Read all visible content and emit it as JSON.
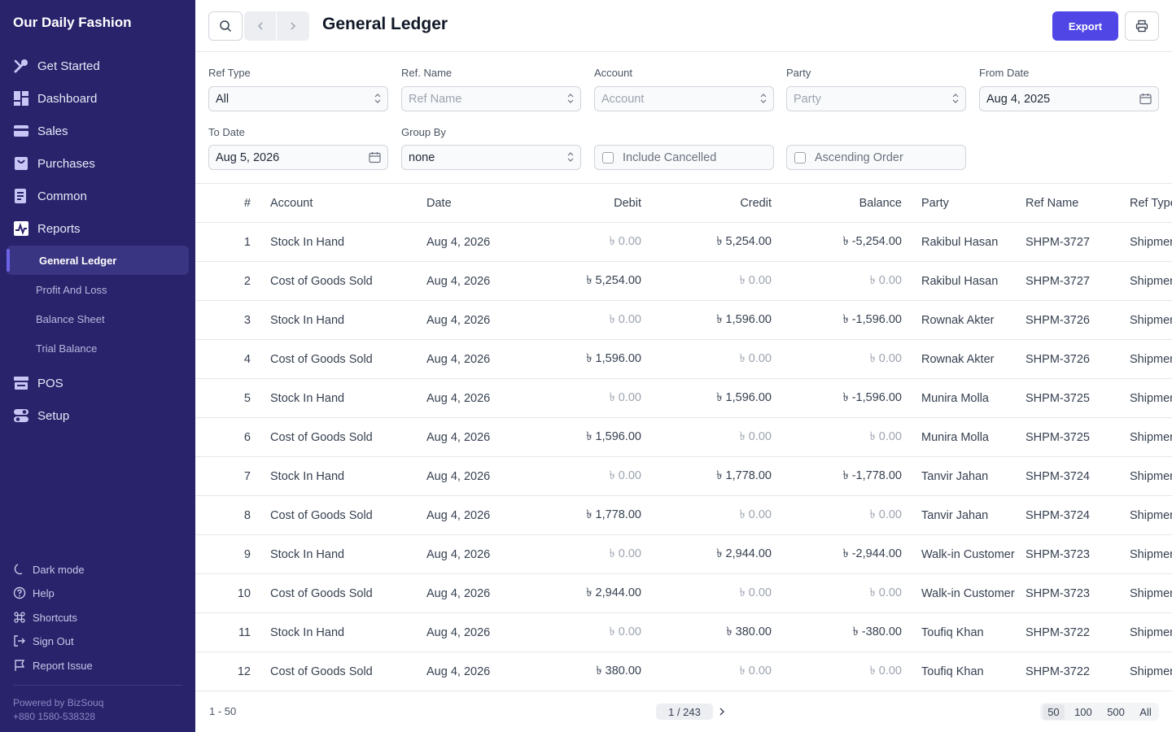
{
  "app": {
    "name": "Our Daily Fashion"
  },
  "sidebar": {
    "items": [
      {
        "label": "Get Started",
        "icon": "tools-icon"
      },
      {
        "label": "Dashboard",
        "icon": "dashboard-icon"
      },
      {
        "label": "Sales",
        "icon": "sales-card-icon"
      },
      {
        "label": "Purchases",
        "icon": "purchases-bag-icon"
      },
      {
        "label": "Common",
        "icon": "common-doc-icon"
      },
      {
        "label": "Reports",
        "icon": "reports-chart-icon"
      },
      {
        "label": "POS",
        "icon": "pos-store-icon"
      },
      {
        "label": "Setup",
        "icon": "setup-toggle-icon"
      }
    ],
    "report_subitems": [
      "General Ledger",
      "Profit And Loss",
      "Balance Sheet",
      "Trial Balance"
    ],
    "active_subitem": "General Ledger",
    "footer_items": [
      "Dark mode",
      "Help",
      "Shortcuts",
      "Sign Out",
      "Report Issue"
    ],
    "powered_by": "Powered by BizSouq",
    "phone": "+880 1580-538328"
  },
  "header": {
    "title": "General Ledger",
    "export_label": "Export"
  },
  "filters": {
    "ref_type": {
      "label": "Ref Type",
      "value": "All"
    },
    "ref_name": {
      "label": "Ref. Name",
      "placeholder": "Ref Name"
    },
    "account": {
      "label": "Account",
      "placeholder": "Account"
    },
    "party": {
      "label": "Party",
      "placeholder": "Party"
    },
    "from_date": {
      "label": "From Date",
      "value": "Aug 4, 2025"
    },
    "to_date": {
      "label": "To Date",
      "value": "Aug 5, 2026"
    },
    "group_by": {
      "label": "Group By",
      "value": "none"
    },
    "include_cancelled": {
      "label": "Include Cancelled",
      "checked": false
    },
    "ascending_order": {
      "label": "Ascending Order",
      "checked": false
    }
  },
  "table": {
    "columns": [
      "#",
      "Account",
      "Date",
      "Debit",
      "Credit",
      "Balance",
      "Party",
      "Ref Name",
      "Ref Type"
    ],
    "rows": [
      {
        "num": "1",
        "account": "Stock In Hand",
        "date": "Aug 4, 2026",
        "debit": "৳ 0.00",
        "credit": "৳ 5,254.00",
        "balance": "৳ -5,254.00",
        "party": "Rakibul Hasan",
        "ref_name": "SHPM-3727",
        "ref_type": "Shipment"
      },
      {
        "num": "2",
        "account": "Cost of Goods Sold",
        "date": "Aug 4, 2026",
        "debit": "৳ 5,254.00",
        "credit": "৳ 0.00",
        "balance": "৳ 0.00",
        "party": "Rakibul Hasan",
        "ref_name": "SHPM-3727",
        "ref_type": "Shipment"
      },
      {
        "num": "3",
        "account": "Stock In Hand",
        "date": "Aug 4, 2026",
        "debit": "৳ 0.00",
        "credit": "৳ 1,596.00",
        "balance": "৳ -1,596.00",
        "party": "Rownak Akter",
        "ref_name": "SHPM-3726",
        "ref_type": "Shipment"
      },
      {
        "num": "4",
        "account": "Cost of Goods Sold",
        "date": "Aug 4, 2026",
        "debit": "৳ 1,596.00",
        "credit": "৳ 0.00",
        "balance": "৳ 0.00",
        "party": "Rownak Akter",
        "ref_name": "SHPM-3726",
        "ref_type": "Shipment"
      },
      {
        "num": "5",
        "account": "Stock In Hand",
        "date": "Aug 4, 2026",
        "debit": "৳ 0.00",
        "credit": "৳ 1,596.00",
        "balance": "৳ -1,596.00",
        "party": "Munira Molla",
        "ref_name": "SHPM-3725",
        "ref_type": "Shipment"
      },
      {
        "num": "6",
        "account": "Cost of Goods Sold",
        "date": "Aug 4, 2026",
        "debit": "৳ 1,596.00",
        "credit": "৳ 0.00",
        "balance": "৳ 0.00",
        "party": "Munira Molla",
        "ref_name": "SHPM-3725",
        "ref_type": "Shipment"
      },
      {
        "num": "7",
        "account": "Stock In Hand",
        "date": "Aug 4, 2026",
        "debit": "৳ 0.00",
        "credit": "৳ 1,778.00",
        "balance": "৳ -1,778.00",
        "party": "Tanvir Jahan",
        "ref_name": "SHPM-3724",
        "ref_type": "Shipment"
      },
      {
        "num": "8",
        "account": "Cost of Goods Sold",
        "date": "Aug 4, 2026",
        "debit": "৳ 1,778.00",
        "credit": "৳ 0.00",
        "balance": "৳ 0.00",
        "party": "Tanvir Jahan",
        "ref_name": "SHPM-3724",
        "ref_type": "Shipment"
      },
      {
        "num": "9",
        "account": "Stock In Hand",
        "date": "Aug 4, 2026",
        "debit": "৳ 0.00",
        "credit": "৳ 2,944.00",
        "balance": "৳ -2,944.00",
        "party": "Walk-in Customer",
        "ref_name": "SHPM-3723",
        "ref_type": "Shipment"
      },
      {
        "num": "10",
        "account": "Cost of Goods Sold",
        "date": "Aug 4, 2026",
        "debit": "৳ 2,944.00",
        "credit": "৳ 0.00",
        "balance": "৳ 0.00",
        "party": "Walk-in Customer",
        "ref_name": "SHPM-3723",
        "ref_type": "Shipment"
      },
      {
        "num": "11",
        "account": "Stock In Hand",
        "date": "Aug 4, 2026",
        "debit": "৳ 0.00",
        "credit": "৳ 380.00",
        "balance": "৳ -380.00",
        "party": "Toufiq Khan",
        "ref_name": "SHPM-3722",
        "ref_type": "Shipment"
      },
      {
        "num": "12",
        "account": "Cost of Goods Sold",
        "date": "Aug 4, 2026",
        "debit": "৳ 380.00",
        "credit": "৳ 0.00",
        "balance": "৳ 0.00",
        "party": "Toufiq Khan",
        "ref_name": "SHPM-3722",
        "ref_type": "Shipment"
      }
    ]
  },
  "footer": {
    "range": "1 - 50",
    "page": "1 / 243",
    "page_sizes": [
      "50",
      "100",
      "500",
      "All"
    ],
    "selected_page_size": "50"
  },
  "colors": {
    "sidebar_bg": "#28236b",
    "accent": "#4f46e5"
  }
}
